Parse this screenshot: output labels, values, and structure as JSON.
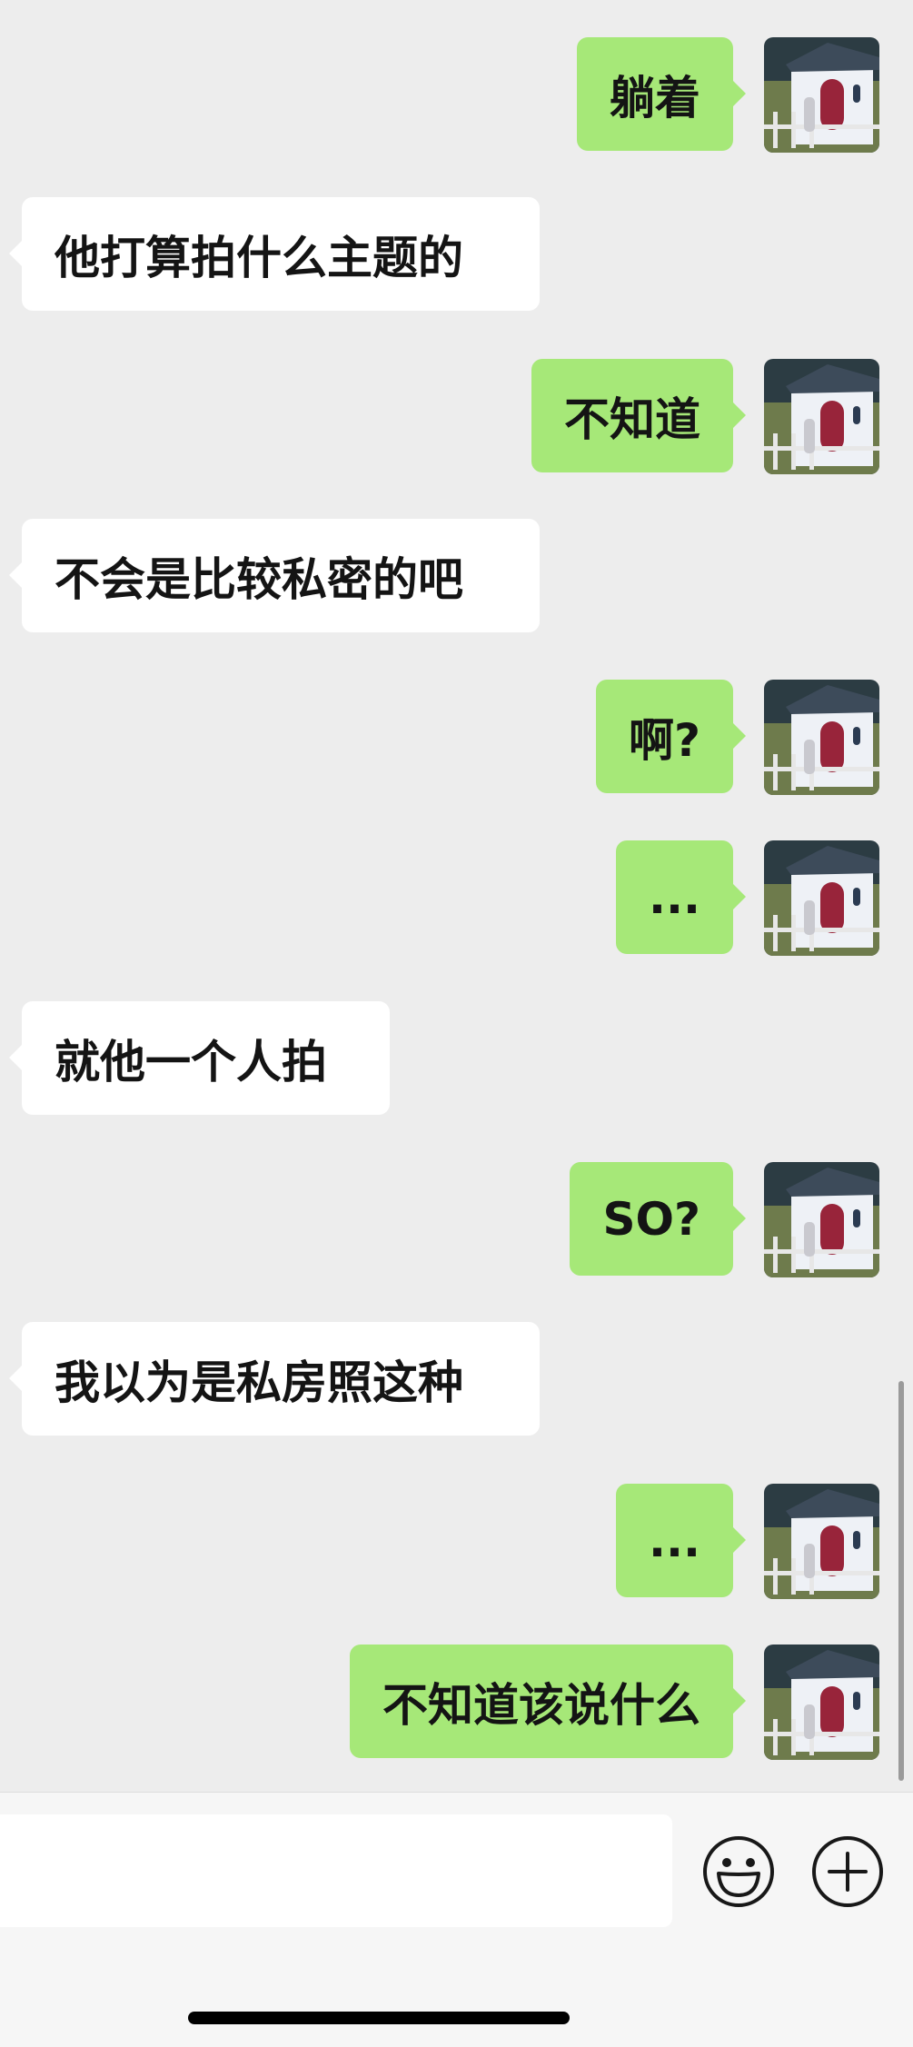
{
  "messages": [
    {
      "side": "sent",
      "text": "躺着"
    },
    {
      "side": "recv",
      "text": "他打算拍什么主题的"
    },
    {
      "side": "sent",
      "text": "不知道"
    },
    {
      "side": "recv",
      "text": "不会是比较私密的吧"
    },
    {
      "side": "sent",
      "text": "啊?"
    },
    {
      "side": "sent",
      "text": "..."
    },
    {
      "side": "recv",
      "text": "就他一个人拍"
    },
    {
      "side": "sent",
      "text": "SO?"
    },
    {
      "side": "recv",
      "text": "我以为是私房照这种"
    },
    {
      "side": "sent",
      "text": "..."
    },
    {
      "side": "sent",
      "text": "不知道该说什么"
    }
  ],
  "input": {
    "value": "",
    "placeholder": ""
  },
  "icons": {
    "emoji": "smiley-face-icon",
    "more": "plus-circle-icon",
    "avatar": "avatar-house-photo"
  },
  "colors": {
    "chat_background": "#ededed",
    "sent_bubble": "#a6e878",
    "received_bubble": "#ffffff",
    "input_bar": "#f6f6f6"
  }
}
